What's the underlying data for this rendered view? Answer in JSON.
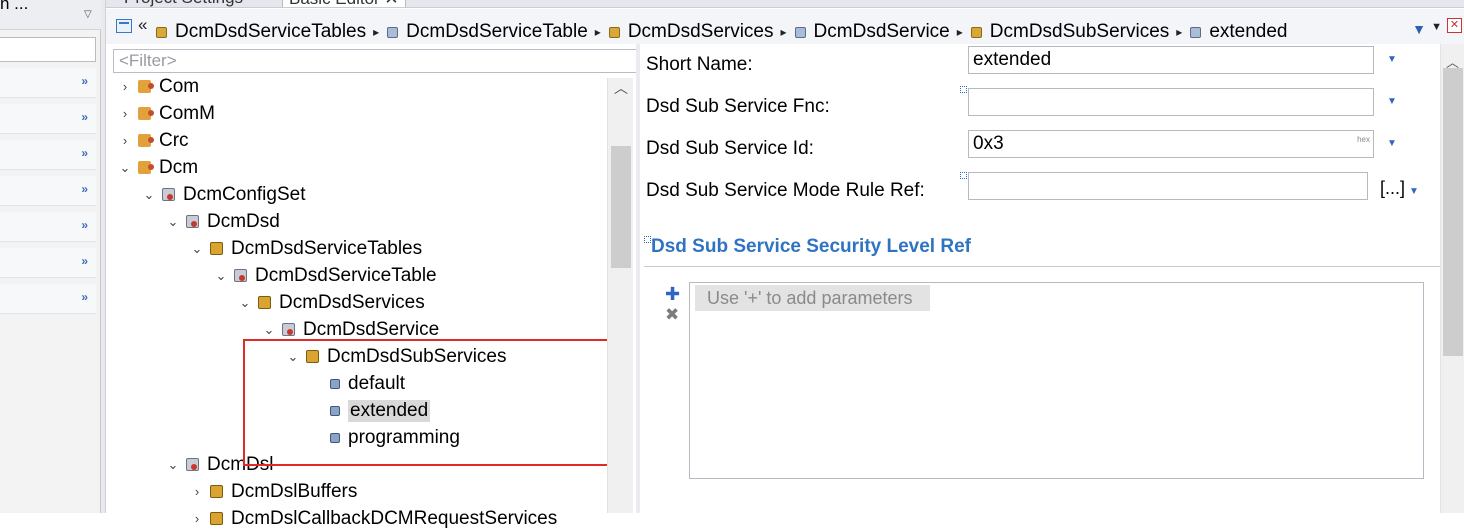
{
  "left_panel": {
    "top_text": "n ...",
    "chevron": "»"
  },
  "tabs": [
    {
      "label": "Project Settings"
    },
    {
      "label": "Basic Editor ✕"
    }
  ],
  "breadcrumb": {
    "back_glyph": "«",
    "items": [
      {
        "label": "DcmDsdServiceTables",
        "icon": "container-icon"
      },
      {
        "label": "DcmDsdServiceTable",
        "icon": "item-icon"
      },
      {
        "label": "DcmDsdServices",
        "icon": "container-icon"
      },
      {
        "label": "DcmDsdService",
        "icon": "item-icon"
      },
      {
        "label": "DcmDsdSubServices",
        "icon": "container-icon"
      },
      {
        "label": "extended",
        "icon": "item-icon"
      }
    ],
    "separator": "▸"
  },
  "tree": {
    "filter_placeholder": "<Filter>",
    "nodes": [
      {
        "label": "Com",
        "icon": "module-icon",
        "twisty": "›"
      },
      {
        "label": "ComM",
        "icon": "module-icon",
        "twisty": "›"
      },
      {
        "label": "Crc",
        "icon": "module-icon",
        "twisty": "›"
      },
      {
        "label": "Dcm",
        "icon": "module-icon",
        "twisty": "⌄"
      },
      {
        "label": "DcmConfigSet",
        "icon": "container-icon",
        "twisty": "⌄"
      },
      {
        "label": "DcmDsd",
        "icon": "container-icon",
        "twisty": "⌄"
      },
      {
        "label": "DcmDsdServiceTables",
        "icon": "list-container-icon",
        "twisty": "⌄"
      },
      {
        "label": "DcmDsdServiceTable",
        "icon": "container-icon",
        "twisty": "⌄"
      },
      {
        "label": "DcmDsdServices",
        "icon": "list-container-icon",
        "twisty": "⌄"
      },
      {
        "label": "DcmDsdService",
        "icon": "container-icon",
        "twisty": "⌄"
      },
      {
        "label": "DcmDsdSubServices",
        "icon": "list-container-icon",
        "twisty": "⌄"
      },
      {
        "label": "default",
        "icon": "item-icon",
        "twisty": ""
      },
      {
        "label": "extended",
        "icon": "item-icon",
        "twisty": "",
        "selected": true
      },
      {
        "label": "programming",
        "icon": "item-icon",
        "twisty": ""
      },
      {
        "label": "DcmDsl",
        "icon": "container-icon",
        "twisty": "⌄"
      },
      {
        "label": "DcmDslBuffers",
        "icon": "list-container-icon",
        "twisty": "›"
      },
      {
        "label": "DcmDslCallbackDCMRequestServices",
        "icon": "list-container-icon",
        "twisty": "›"
      }
    ]
  },
  "form": {
    "short_name": {
      "label": "Short Name:",
      "value": "extended"
    },
    "sub_service_fnc": {
      "label": "Dsd Sub Service Fnc:",
      "value": ""
    },
    "sub_service_id": {
      "label": "Dsd Sub Service Id:",
      "value": "0x3",
      "format_badge": "hex"
    },
    "mode_rule_ref": {
      "label": "Dsd Sub Service Mode Rule Ref:",
      "value": "",
      "button": "[...]"
    },
    "security_section": {
      "title": "Dsd Sub Service Security Level Ref",
      "hint": "Use '+' to add parameters"
    }
  },
  "colors": {
    "accent": "#2f74c3",
    "highlight_box": "#e02a2a",
    "selected_row": "#d9d9d9"
  }
}
